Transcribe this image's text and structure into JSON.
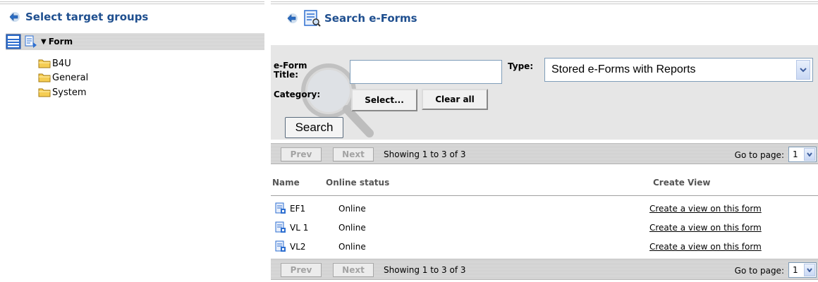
{
  "left_panel": {
    "title": "Select target groups",
    "tree_root_label": "Form",
    "folders": [
      "B4U",
      "General",
      "System"
    ]
  },
  "right_panel": {
    "title": "Search e-Forms",
    "form": {
      "title_label_line1": "e-Form",
      "title_label_line2": "Title:",
      "title_value": "",
      "type_label": "Type:",
      "type_selected": "Stored e-Forms with Reports",
      "category_label": "Category:",
      "select_button": "Select...",
      "clear_button": "Clear all",
      "search_button": "Search"
    },
    "pager": {
      "prev": "Prev",
      "next": "Next",
      "showing": "Showing 1 to 3 of 3",
      "goto_label": "Go to page:",
      "page": "1"
    },
    "columns": {
      "name": "Name",
      "status": "Online status",
      "create": "Create View"
    },
    "rows": [
      {
        "name": "EF1",
        "status": "Online",
        "action": "Create a view on this form"
      },
      {
        "name": "VL 1",
        "status": "Online",
        "action": "Create a view on this form"
      },
      {
        "name": "VL2",
        "status": "Online",
        "action": "Create a view on this form"
      }
    ]
  },
  "colors": {
    "title_blue": "#1f4f8f",
    "form_bg": "#e6e6e6"
  }
}
